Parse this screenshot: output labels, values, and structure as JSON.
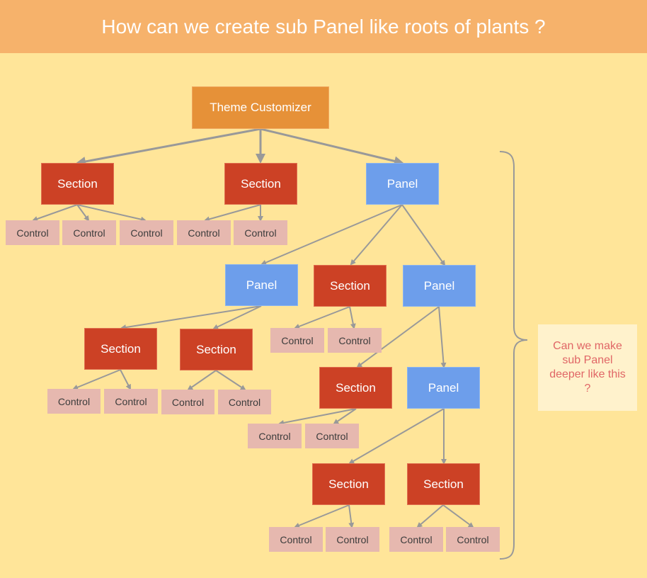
{
  "title": "How can we create sub Panel like roots of plants ?",
  "colors": {
    "background": "#FFE599",
    "title_bar": "#F6B26B",
    "root": "#E69138",
    "section": "#CC4125",
    "panel": "#6D9EEB",
    "control": "#E6B8AF",
    "edge": "#999999",
    "note_bg": "#FFF2CC",
    "note_text": "#E06666"
  },
  "nodes": [
    {
      "id": "root",
      "type": "root",
      "label": "Theme Customizer"
    },
    {
      "id": "s1",
      "type": "section",
      "label": "Section",
      "parent": "root"
    },
    {
      "id": "s2",
      "type": "section",
      "label": "Section",
      "parent": "root"
    },
    {
      "id": "p1",
      "type": "panel",
      "label": "Panel",
      "parent": "root"
    },
    {
      "id": "c1",
      "type": "control",
      "label": "Control",
      "parent": "s1"
    },
    {
      "id": "c2",
      "type": "control",
      "label": "Control",
      "parent": "s1"
    },
    {
      "id": "c3",
      "type": "control",
      "label": "Control",
      "parent": "s1"
    },
    {
      "id": "c4",
      "type": "control",
      "label": "Control",
      "parent": "s2"
    },
    {
      "id": "c5",
      "type": "control",
      "label": "Control",
      "parent": "s2"
    },
    {
      "id": "p2",
      "type": "panel",
      "label": "Panel",
      "parent": "p1"
    },
    {
      "id": "s3",
      "type": "section",
      "label": "Section",
      "parent": "p1"
    },
    {
      "id": "p3",
      "type": "panel",
      "label": "Panel",
      "parent": "p1"
    },
    {
      "id": "c6",
      "type": "control",
      "label": "Control",
      "parent": "s3"
    },
    {
      "id": "c7",
      "type": "control",
      "label": "Control",
      "parent": "s3"
    },
    {
      "id": "s4",
      "type": "section",
      "label": "Section",
      "parent": "p2"
    },
    {
      "id": "s5",
      "type": "section",
      "label": "Section",
      "parent": "p2"
    },
    {
      "id": "c8",
      "type": "control",
      "label": "Control",
      "parent": "s4"
    },
    {
      "id": "c9",
      "type": "control",
      "label": "Control",
      "parent": "s4"
    },
    {
      "id": "c10",
      "type": "control",
      "label": "Control",
      "parent": "s5"
    },
    {
      "id": "c11",
      "type": "control",
      "label": "Control",
      "parent": "s5"
    },
    {
      "id": "s6",
      "type": "section",
      "label": "Section",
      "parent": "p3"
    },
    {
      "id": "p4",
      "type": "panel",
      "label": "Panel",
      "parent": "p3"
    },
    {
      "id": "c12",
      "type": "control",
      "label": "Control",
      "parent": "s6"
    },
    {
      "id": "c13",
      "type": "control",
      "label": "Control",
      "parent": "s6"
    },
    {
      "id": "s7",
      "type": "section",
      "label": "Section",
      "parent": "p4"
    },
    {
      "id": "s8",
      "type": "section",
      "label": "Section",
      "parent": "p4"
    },
    {
      "id": "c14",
      "type": "control",
      "label": "Control",
      "parent": "s7"
    },
    {
      "id": "c15",
      "type": "control",
      "label": "Control",
      "parent": "s7"
    },
    {
      "id": "c16",
      "type": "control",
      "label": "Control",
      "parent": "s8"
    },
    {
      "id": "c17",
      "type": "control",
      "label": "Control",
      "parent": "s8"
    }
  ],
  "note": {
    "text": "Can we make sub Panel deeper like this ?"
  }
}
